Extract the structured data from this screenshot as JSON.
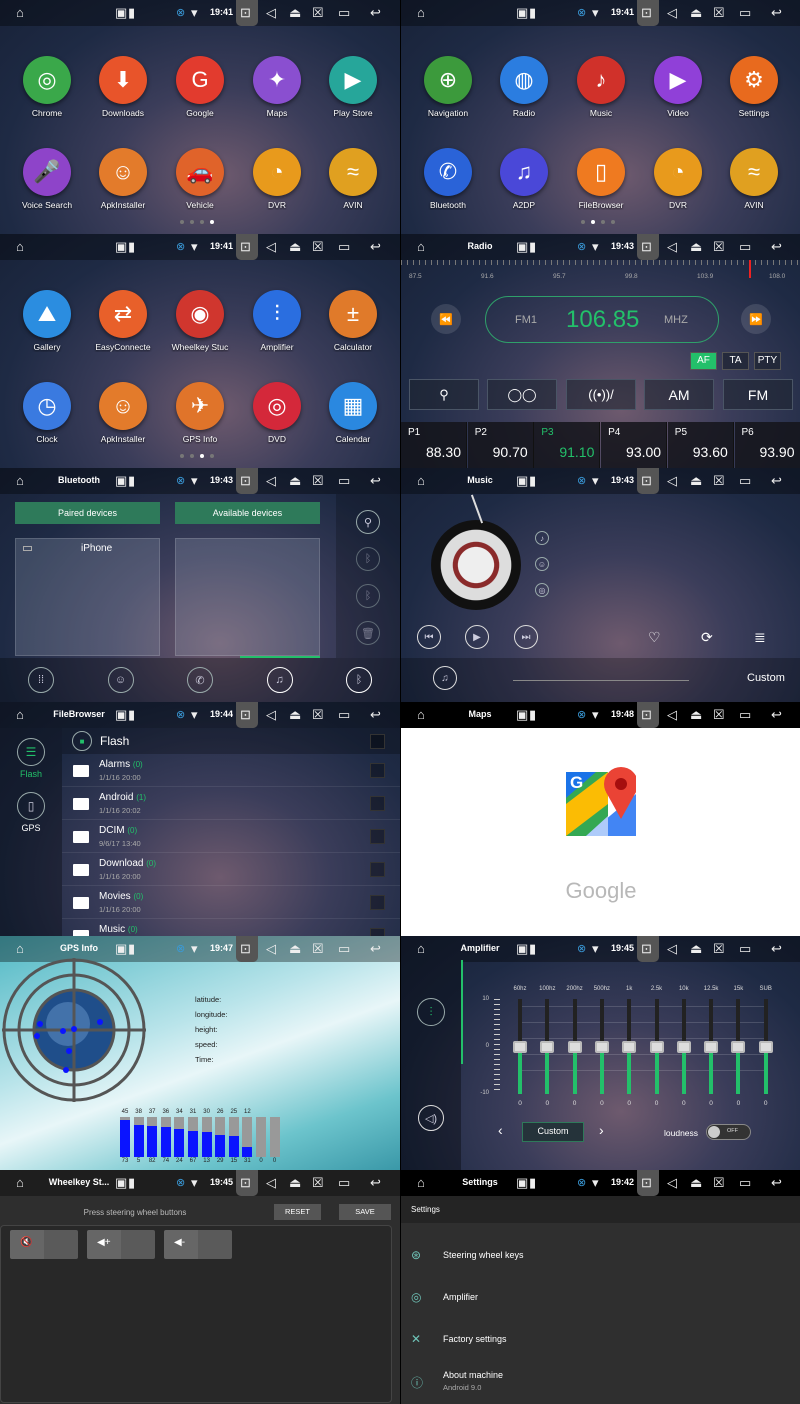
{
  "icons": {
    "home": "⌂",
    "image": "▣",
    "sd": "▮",
    "bt_badge": "⊗",
    "wifi": "▾",
    "screenshot": "⊡",
    "volume": "◁",
    "eject": "⏏",
    "close": "☒",
    "window": "▭",
    "back": "↩"
  },
  "accent": "#23c06a",
  "screens": [
    {
      "title": "",
      "time": "19:41",
      "page_count": 4,
      "active_page": 3,
      "apps": [
        {
          "label": "Chrome",
          "color": "#3aa84a",
          "glyph": "◎"
        },
        {
          "label": "Downloads",
          "color": "#e8542a",
          "glyph": "⬇"
        },
        {
          "label": "Google",
          "color": "#e23b2e",
          "glyph": "G"
        },
        {
          "label": "Maps",
          "color": "#8a4fd0",
          "glyph": "✦"
        },
        {
          "label": "Play Store",
          "color": "#26a69a",
          "glyph": "▶"
        },
        {
          "label": "Voice Search",
          "color": "#8e44c9",
          "glyph": "🎤"
        },
        {
          "label": "ApkInstaller",
          "color": "#e37b2b",
          "glyph": "☺"
        },
        {
          "label": "Vehicle",
          "color": "#e0632a",
          "glyph": "🚗"
        },
        {
          "label": "DVR",
          "color": "#e89a1c",
          "glyph": "◔"
        },
        {
          "label": "AVIN",
          "color": "#e0a020",
          "glyph": "≈"
        }
      ]
    },
    {
      "title": "",
      "time": "19:41",
      "page_count": 4,
      "active_page": 1,
      "apps": [
        {
          "label": "Navigation",
          "color": "#3c9a3c",
          "glyph": "⊕"
        },
        {
          "label": "Radio",
          "color": "#2b7de0",
          "glyph": "◍"
        },
        {
          "label": "Music",
          "color": "#d0312a",
          "glyph": "♪"
        },
        {
          "label": "Video",
          "color": "#9040d8",
          "glyph": "▶"
        },
        {
          "label": "Settings",
          "color": "#e86a1e",
          "glyph": "⚙"
        },
        {
          "label": "Bluetooth",
          "color": "#2a63d8",
          "glyph": "✆"
        },
        {
          "label": "A2DP",
          "color": "#4a48d8",
          "glyph": "♫"
        },
        {
          "label": "FileBrowser",
          "color": "#ef7a20",
          "glyph": "▯"
        },
        {
          "label": "DVR",
          "color": "#e89a1c",
          "glyph": "◔"
        },
        {
          "label": "AVIN",
          "color": "#e0a020",
          "glyph": "≈"
        }
      ]
    },
    {
      "title": "",
      "time": "19:41",
      "page_count": 4,
      "active_page": 2,
      "apps": [
        {
          "label": "Gallery",
          "color": "#2b8de0",
          "glyph": "⛰"
        },
        {
          "label": "EasyConnecte",
          "color": "#e8602a",
          "glyph": "⇄"
        },
        {
          "label": "Wheelkey Stuc",
          "color": "#d0362e",
          "glyph": "◉"
        },
        {
          "label": "Amplifier",
          "color": "#2a6ee0",
          "glyph": "⫶"
        },
        {
          "label": "Calculator",
          "color": "#e07a2a",
          "glyph": "±"
        },
        {
          "label": "Clock",
          "color": "#3a7ae0",
          "glyph": "◷"
        },
        {
          "label": "ApkInstaller",
          "color": "#e37b2b",
          "glyph": "☺"
        },
        {
          "label": "GPS Info",
          "color": "#e0742a",
          "glyph": "✈"
        },
        {
          "label": "DVD",
          "color": "#d4283a",
          "glyph": "◎"
        },
        {
          "label": "Calendar",
          "color": "#2a88e0",
          "glyph": "▦"
        }
      ]
    },
    {
      "title": "Radio",
      "time": "19:43"
    },
    {
      "title": "Bluetooth",
      "time": "19:43"
    },
    {
      "title": "Music",
      "time": "19:43"
    },
    {
      "title": "FileBrowser",
      "time": "19:44"
    },
    {
      "title": "Maps",
      "time": "19:48"
    },
    {
      "title": "GPS Info",
      "time": "19:47"
    },
    {
      "title": "Amplifier",
      "time": "19:45"
    },
    {
      "title": "Wheelkey St...",
      "time": "19:45"
    },
    {
      "title": "Settings",
      "time": "19:42"
    }
  ],
  "radio": {
    "scale": [
      "87.5",
      "91.6",
      "95.7",
      "99.8",
      "103.9",
      "108.0"
    ],
    "band": "FM1",
    "frequency": "106.85",
    "unit": "MHZ",
    "scale_min": 87.5,
    "scale_max": 108.0,
    "toggles": [
      {
        "label": "AF",
        "active": true
      },
      {
        "label": "TA",
        "active": false
      },
      {
        "label": "PTY",
        "active": false
      }
    ],
    "buttons": [
      {
        "label": "",
        "icon": "search-icon",
        "glyph": "⚲"
      },
      {
        "label": "",
        "icon": "stereo-icon",
        "glyph": "◯◯"
      },
      {
        "label": "",
        "icon": "local-distance-icon",
        "glyph": "((•))/"
      },
      {
        "label": "AM"
      },
      {
        "label": "FM"
      }
    ],
    "presets": [
      {
        "name": "P1",
        "freq": "88.30"
      },
      {
        "name": "P2",
        "freq": "90.70"
      },
      {
        "name": "P3",
        "freq": "91.10",
        "active": true
      },
      {
        "name": "P4",
        "freq": "93.00"
      },
      {
        "name": "P5",
        "freq": "93.60"
      },
      {
        "name": "P6",
        "freq": "93.90"
      }
    ]
  },
  "bluetooth": {
    "tabs": [
      "Paired devices",
      "Available devices"
    ],
    "paired": [
      "iPhone"
    ]
  },
  "music": {
    "mode": "Custom"
  },
  "files": {
    "sidebar": [
      {
        "label": "Flash",
        "active": true
      },
      {
        "label": "GPS"
      }
    ],
    "header": "Flash",
    "items": [
      {
        "name": "Alarms",
        "count": "(0)",
        "date": "1/1/16 20:00"
      },
      {
        "name": "Android",
        "count": "(1)",
        "date": "1/1/16 20:02"
      },
      {
        "name": "DCIM",
        "count": "(0)",
        "date": "9/6/17 13:40"
      },
      {
        "name": "Download",
        "count": "(0)",
        "date": "1/1/16 20:00"
      },
      {
        "name": "Movies",
        "count": "(0)",
        "date": "1/1/16 20:00"
      },
      {
        "name": "Music",
        "count": "(0)",
        "date": ""
      }
    ]
  },
  "maps": {
    "wordmark": "Google"
  },
  "gps": {
    "labels": [
      "latitude:",
      "longitude:",
      "height:",
      "speed:",
      "Time:"
    ],
    "snr": [
      45,
      38,
      37,
      36,
      34,
      31,
      30,
      26,
      25,
      12,
      null,
      null
    ],
    "ids": [
      "73",
      "5",
      "82",
      "74",
      "24",
      "67",
      "13",
      "29",
      "15",
      "31",
      "0",
      "0"
    ],
    "snr_max": 48
  },
  "amplifier": {
    "bands": [
      "60hz",
      "100hz",
      "200hz",
      "500hz",
      "1k",
      "2.5k",
      "10k",
      "12.5k",
      "15k",
      "SUB"
    ],
    "values": [
      0,
      0,
      0,
      0,
      0,
      0,
      0,
      0,
      0,
      0
    ],
    "scale": [
      "10",
      "0",
      "-10"
    ],
    "range": [
      -10,
      10
    ],
    "preset": "Custom",
    "loudness_label": "loudness",
    "loudness_state": "OFF"
  },
  "wheelkey": {
    "instruction": "Press steering wheel buttons",
    "reset": "RESET",
    "save": "SAVE",
    "keys": [
      {
        "icon": "mute-icon",
        "glyph": "🔇"
      },
      {
        "icon": "volume-up-icon",
        "glyph": "◀+"
      },
      {
        "icon": "volume-down-icon",
        "glyph": "◀-"
      }
    ]
  },
  "settings": {
    "header": "Settings",
    "items": [
      {
        "label": "Steering wheel keys",
        "glyph": "⊛",
        "icon": "steering-wheel-icon"
      },
      {
        "label": "Amplifier",
        "glyph": "◎",
        "icon": "amplifier-icon"
      },
      {
        "label": "Factory settings",
        "glyph": "✕",
        "icon": "tools-icon"
      },
      {
        "label": "About machine",
        "sub": "Android 9.0",
        "glyph": "ⓘ",
        "icon": "info-icon"
      }
    ]
  }
}
